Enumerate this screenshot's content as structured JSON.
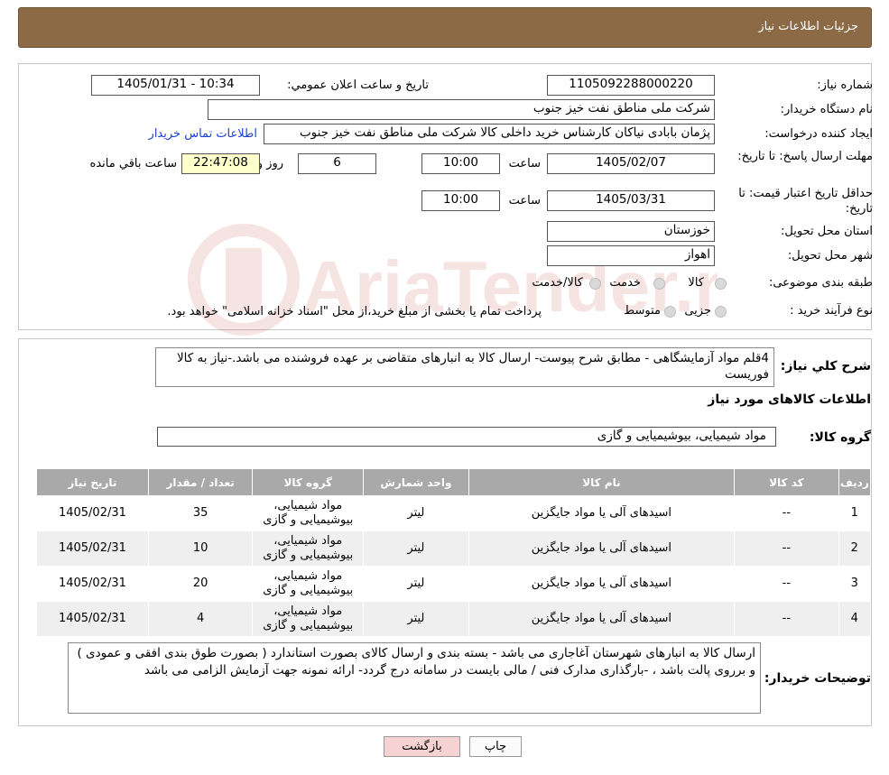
{
  "header": {
    "title": "جزئیات اطلاعات نیاز"
  },
  "form": {
    "need_number_label": "شماره نیاز:",
    "need_number": "1105092288000220",
    "announce_label": "تاریخ و ساعت اعلان عمومي:",
    "announce_value": "1405/01/31 - 10:34",
    "buyer_org_label": "نام دستگاه خریدار:",
    "buyer_org": "شرکت ملی مناطق نفت خیز جنوب",
    "requester_label": "ایجاد کننده درخواست:",
    "requester": "پژمان  بابادی نیاکان  کارشناس خرید داخلی کالا  شرکت ملی مناطق نفت خیز جنوب",
    "contact_link": "اطلاعات تماس خریدار",
    "deadline_label": "مهلت ارسال پاسخ: تا تاریخ:",
    "deadline_date": "1405/02/07",
    "time_label": "ساعت",
    "deadline_time": "10:00",
    "days_value": "6",
    "days_label": "روز و",
    "remaining_time": "22:47:08",
    "remaining_label": "ساعت باقي مانده",
    "validity_label": "حداقل تاریخ اعتبار قیمت: تا تاریخ:",
    "validity_date": "1405/03/31",
    "validity_time": "10:00",
    "province_label": "استان محل تحویل:",
    "province": "خوزستان",
    "city_label": "شهر محل تحویل:",
    "city": "اهواز",
    "category_label": "طبقه بندی موضوعی:",
    "category_options": [
      "کالا",
      "خدمت",
      "کالا/خدمت"
    ],
    "process_label": "نوع فرآیند خرید :",
    "process_options": [
      "جزیی",
      "متوسط"
    ],
    "process_note": "پرداخت تمام یا بخشی از مبلغ خرید،از محل \"اسناد خزانه اسلامی\" خواهد بود."
  },
  "summary": {
    "label": "شرح کلي نیاز:",
    "text": "4قلم مواد آزمایشگاهی - مطابق شرح پیوست- ارسال کالا به انبارهای متقاضی بر عهده فروشنده می باشد.-نیاز به کالا فوریست"
  },
  "goods": {
    "section_title": "اطلاعات کالاهای مورد نیاز",
    "group_label": "گروه کالا:",
    "group_value": "مواد شیمیایی، بیوشیمیایی و  گازی",
    "columns": [
      "ردیف",
      "کد کالا",
      "نام کالا",
      "واحد شمارش",
      "گروه کالا",
      "تعداد / مقدار",
      "تاریخ نیاز"
    ],
    "rows": [
      [
        "1",
        "--",
        "اسیدهای آلی یا مواد جایگزین",
        "لیتر",
        "مواد شیمیایی، بیوشیمیایی و گازی",
        "35",
        "1405/02/31"
      ],
      [
        "2",
        "--",
        "اسیدهای آلی یا مواد جایگزین",
        "لیتر",
        "مواد شیمیایی، بیوشیمیایی و گازی",
        "10",
        "1405/02/31"
      ],
      [
        "3",
        "--",
        "اسیدهای آلی یا مواد جایگزین",
        "لیتر",
        "مواد شیمیایی، بیوشیمیایی و گازی",
        "20",
        "1405/02/31"
      ],
      [
        "4",
        "--",
        "اسیدهای آلی یا مواد جایگزین",
        "لیتر",
        "مواد شیمیایی، بیوشیمیایی و گازی",
        "4",
        "1405/02/31"
      ]
    ]
  },
  "buyer_notes": {
    "label": "توضیحات خریدار:",
    "text": "ارسال کالا به انبارهای  شهرستان آغاجاری می باشد  - بسته بندی و ارسال کالای بصورت استاندارد ( بصورت طوق بندی افقی و عمودی ) و برروی پالت باشد ، -بارگذاری مدارک فنی / مالی بایست  در سامانه درج گردد- ارائه نمونه جهت آزمایش الزامی می باشد"
  },
  "buttons": {
    "print": "چاپ",
    "back": "بازگشت"
  },
  "watermark": {
    "text": "AriaTender.neT"
  },
  "colors": {
    "header_bg": "#8b6a45",
    "link": "#1a3fd6",
    "table_header": "#a9a9a9",
    "back_button": "#f6d2d2"
  }
}
